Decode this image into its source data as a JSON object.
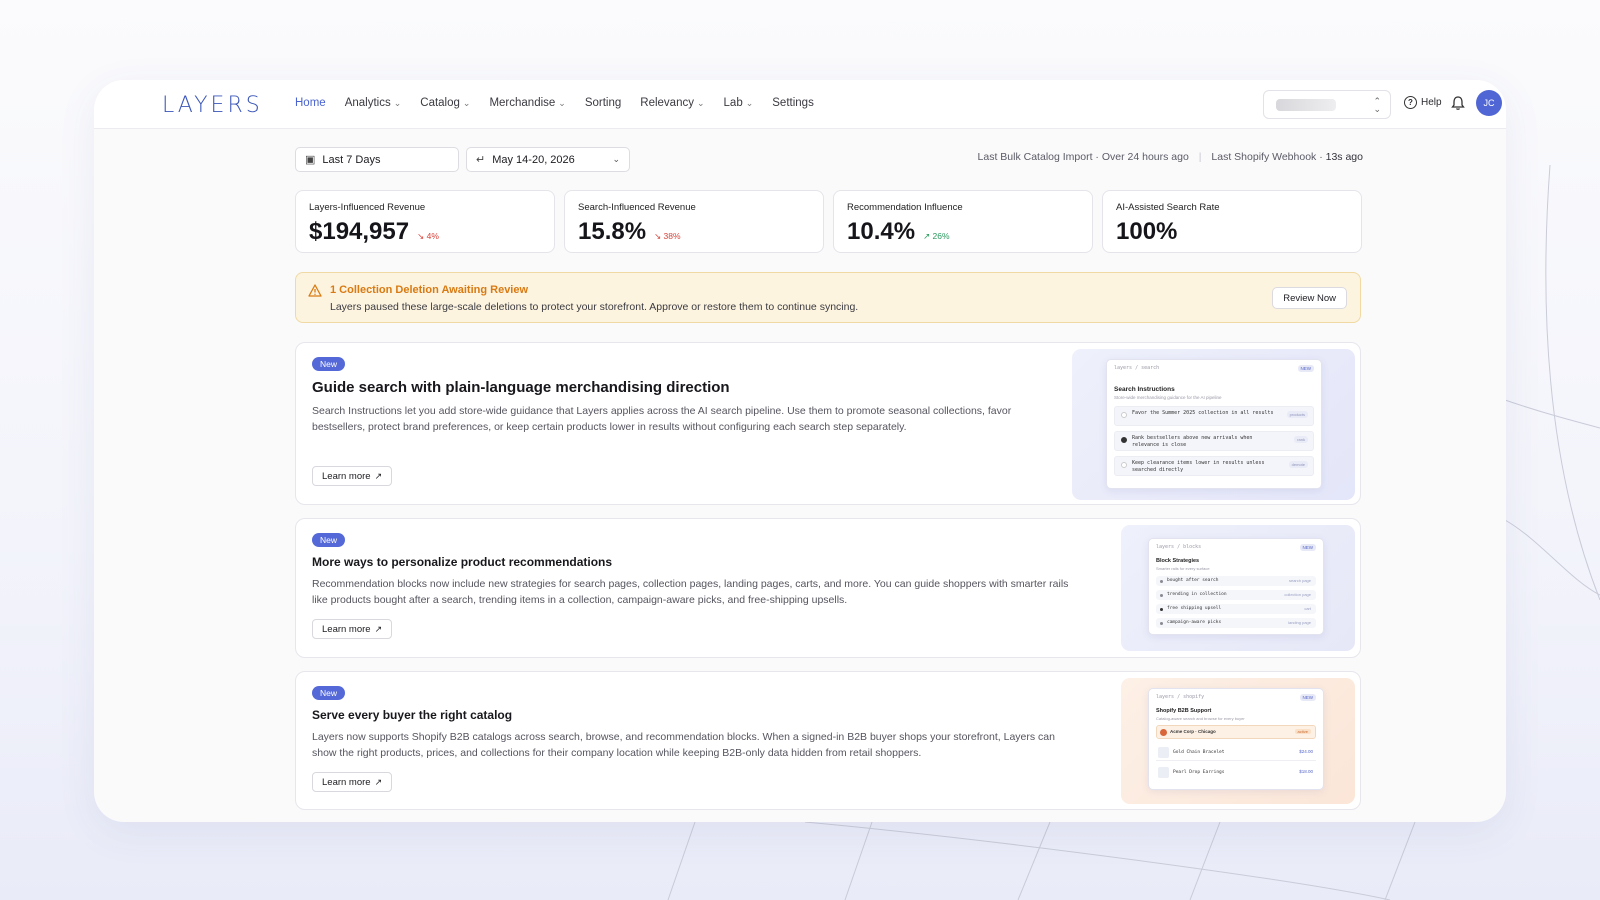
{
  "app": {
    "logo": "LAYERS"
  },
  "nav": {
    "items": [
      {
        "label": "Home",
        "active": true,
        "dropdown": false
      },
      {
        "label": "Analytics",
        "dropdown": true
      },
      {
        "label": "Catalog",
        "dropdown": true
      },
      {
        "label": "Merchandise",
        "dropdown": true
      },
      {
        "label": "Sorting",
        "dropdown": false
      },
      {
        "label": "Relevancy",
        "dropdown": true
      },
      {
        "label": "Lab",
        "dropdown": true
      },
      {
        "label": "Settings",
        "dropdown": false
      }
    ],
    "help_label": "Help",
    "avatar_initials": "JC"
  },
  "filters": {
    "range_label": "Last 7 Days",
    "date_value": "May 14-20, 2026"
  },
  "status": {
    "import_label": "Last Bulk Catalog Import",
    "import_value": "Over 24 hours ago",
    "webhook_label": "Last Shopify Webhook",
    "webhook_value": "13s ago"
  },
  "kpis": [
    {
      "label": "Layers-Influenced Revenue",
      "value": "$194,957",
      "delta": "4%",
      "direction": "down"
    },
    {
      "label": "Search-Influenced Revenue",
      "value": "15.8%",
      "delta": "38%",
      "direction": "down"
    },
    {
      "label": "Recommendation Influence",
      "value": "10.4%",
      "delta": "26%",
      "direction": "up"
    },
    {
      "label": "AI-Assisted Search Rate",
      "value": "100%",
      "delta": "",
      "direction": ""
    }
  ],
  "alert": {
    "title": "1 Collection Deletion Awaiting Review",
    "text": "Layers paused these large-scale deletions to protect your storefront. Approve or restore them to continue syncing.",
    "button": "Review Now"
  },
  "cards": [
    {
      "badge": "New",
      "title": "Guide search with plain-language merchandising direction",
      "text": "Search Instructions let you add store-wide guidance that Layers applies across the AI search pipeline. Use them to promote seasonal collections, favor bestsellers, protect brand preferences, or keep certain products lower in results without configuring each search step separately.",
      "button": "Learn more",
      "preview": {
        "crumb": "layers / search",
        "tag": "NEW",
        "title": "Search Instructions",
        "subtitle": "Store-wide merchandising guidance for the AI pipeline",
        "rows": [
          {
            "text": "Favor the Summer 2025 collection in all results",
            "tag": "products"
          },
          {
            "text": "Rank bestsellers above new arrivals when relevance is close",
            "tag": "rank"
          },
          {
            "text": "Keep clearance items lower in results unless searched directly",
            "tag": "demote"
          }
        ]
      }
    },
    {
      "badge": "New",
      "title": "More ways to personalize product recommendations",
      "text": "Recommendation blocks now include new strategies for search pages, collection pages, landing pages, carts, and more. You can guide shoppers with smarter rails like products bought after a search, trending items in a collection, campaign-aware picks, and free-shipping upsells.",
      "button": "Learn more",
      "preview": {
        "crumb": "layers / blocks",
        "tag": "NEW",
        "title": "Block Strategies",
        "subtitle": "Smarter rails for every surface",
        "rows": [
          {
            "text": "bought after search",
            "tag": "search page"
          },
          {
            "text": "trending in collection",
            "tag": "collection page"
          },
          {
            "text": "free shipping upsell",
            "tag": "cart"
          },
          {
            "text": "campaign-aware picks",
            "tag": "landing page"
          }
        ]
      }
    },
    {
      "badge": "New",
      "title": "Serve every buyer the right catalog",
      "text": "Layers now supports Shopify B2B catalogs across search, browse, and recommendation blocks. When a signed-in B2B buyer shops your storefront, Layers can show the right products, prices, and collections for their company location while keeping B2B-only data hidden from retail shoppers.",
      "button": "Learn more",
      "preview": {
        "crumb": "layers / shopify",
        "tag": "NEW",
        "title": "Shopify B2B Support",
        "subtitle": "Catalog-aware search and browse for every buyer",
        "company": "Acme Corp · Chicago",
        "company_tag": "active",
        "items": [
          {
            "name": "Gold Chain Bracelet",
            "price": "$24.00"
          },
          {
            "name": "Pearl Drop Earrings",
            "price": "$18.00"
          }
        ]
      }
    }
  ],
  "colors": {
    "accent": "#4f66d4",
    "alert_bg": "#fdf4e0",
    "alert_title": "#d97a12",
    "down": "#d8433a",
    "up": "#2a9a5e"
  }
}
